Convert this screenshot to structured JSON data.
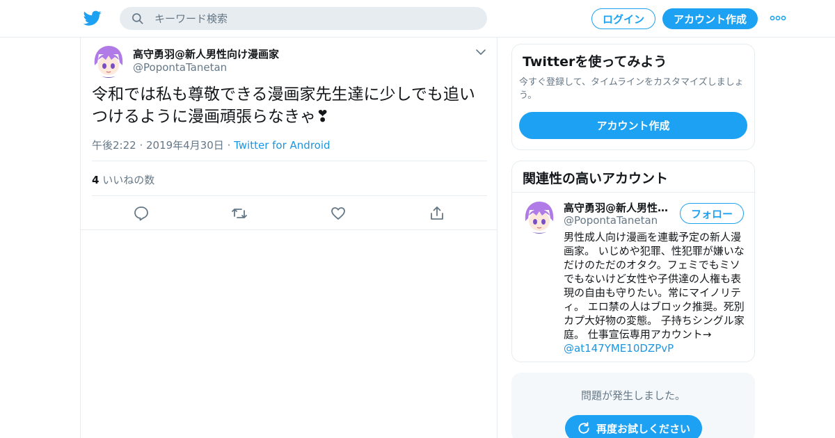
{
  "header": {
    "search_placeholder": "キーワード検索",
    "login_label": "ログイン",
    "signup_label": "アカウント作成",
    "brand_color": "#1da1f2"
  },
  "tweet": {
    "author_name": "高守勇羽@新人男性向け漫画家",
    "author_handle": "@PopontaTanetan",
    "text": "令和では私も尊敬できる漫画家先生達に少しでも追いつけるように漫画頑張らなきゃ❣",
    "timestamp": "午後2:22 · 2019年4月30日",
    "meta_separator": " · ",
    "source": "Twitter for Android",
    "like_count": "4",
    "like_label": " いいねの数"
  },
  "sidebar": {
    "signup_card": {
      "title": "Twitterを使ってみよう",
      "description": "今すぐ登録して、タイムラインをカスタマイズしましょう。",
      "button_label": "アカウント作成"
    },
    "related": {
      "title": "関連性の高いアカウント",
      "name": "高守勇羽@新人男性向け漫画家",
      "handle": "@PopontaTanetan",
      "follow_label": "フォロー",
      "bio": "男性成人向け漫画を連載予定の新人漫画家。 いじめや犯罪、性犯罪が嫌いなだけのただのオタク。フェミでもミソでもないけど女性や子供達の人権も表現の自由も守りたい。常にマイノリティ。 エロ禁の人はブロック推奨。死別カプ大好物の変態。 子持ちシングル家庭。 仕事宣伝専用アカウント→",
      "bio_link": "@at147YME10DZPvP"
    },
    "error_card": {
      "message": "問題が発生しました。",
      "retry_label": "再度お試しください"
    }
  }
}
